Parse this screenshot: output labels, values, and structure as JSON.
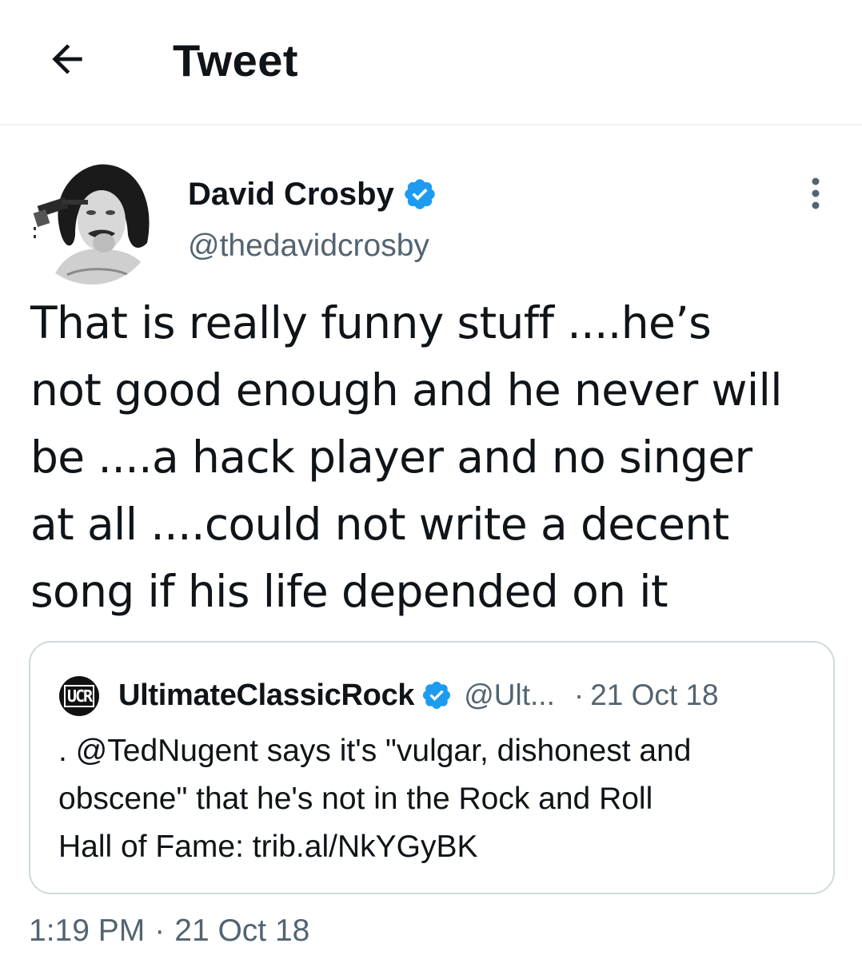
{
  "header": {
    "back_icon": "arrow-left-icon",
    "title": "Tweet"
  },
  "tweet": {
    "author": {
      "name": "David Crosby",
      "handle": "@thedavidcrosby",
      "verified": true,
      "avatar": "avatar-photo"
    },
    "more_icon": "more-vertical-icon",
    "text": "That is really funny stuff ....he’s\nnot good enough and he never will\nbe ....a hack player and no singer\nat all ....could not write a decent\nsong if his life depended on it",
    "quoted": {
      "avatar_text": "UCR",
      "name": "UltimateClassicRock",
      "verified": true,
      "handle": "@Ult...",
      "separator": "·",
      "date": "21 Oct 18",
      "text": ". @TedNugent says it's \"vulgar, dishonest and\nobscene\" that he's not in the Rock and Roll\nHall of Fame: trib.al/NkYGyBK"
    },
    "time": "1:19 PM",
    "separator": "·",
    "date": "21 Oct 18"
  },
  "colors": {
    "text_primary": "#0f1419",
    "text_secondary": "#536471",
    "verified_blue": "#1d9bf0",
    "border": "#cfd9de",
    "divider": "#eff3f4"
  }
}
